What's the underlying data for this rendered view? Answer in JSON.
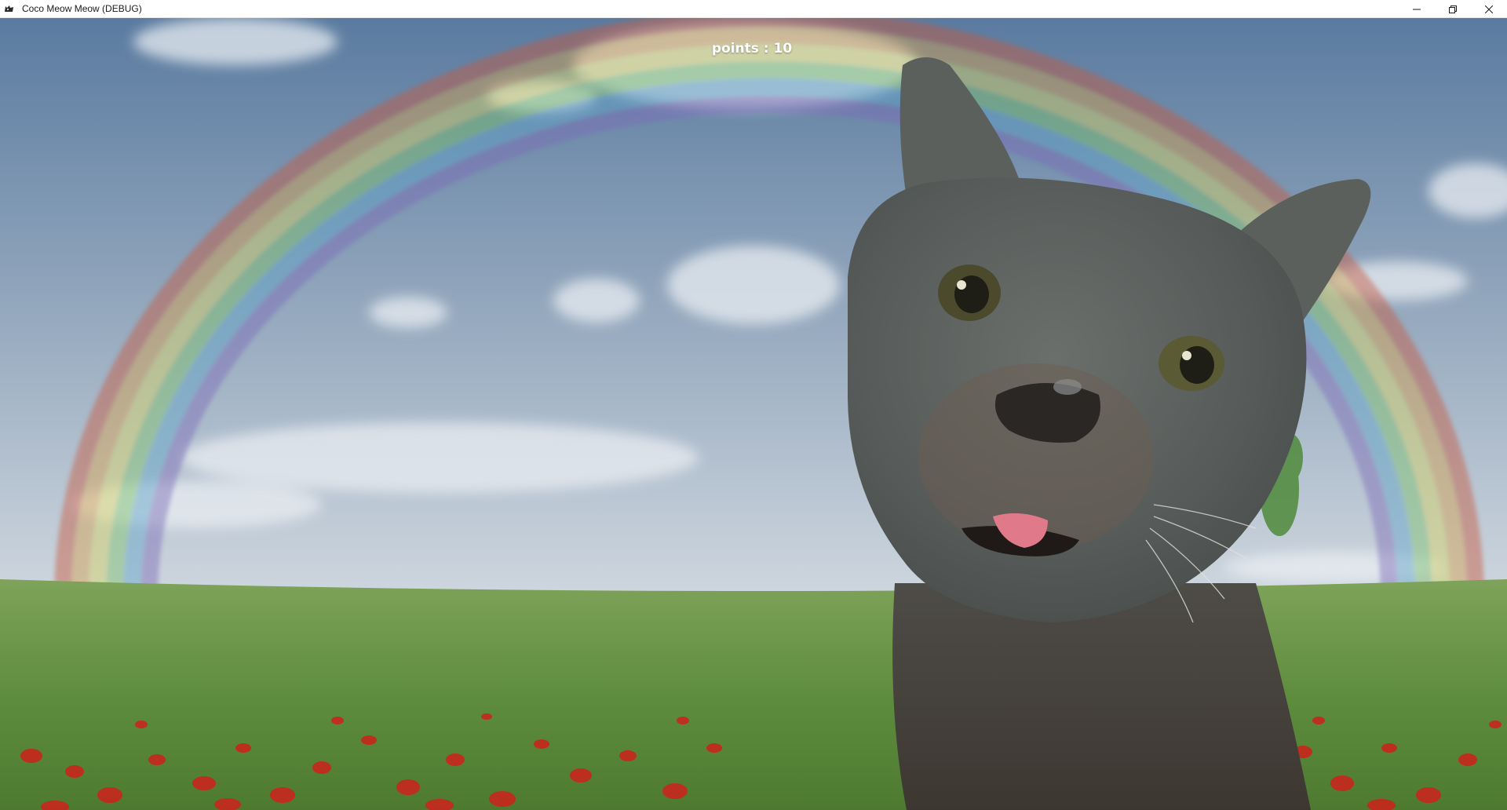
{
  "window": {
    "title": "Coco Meow Meow (DEBUG)",
    "controls": {
      "minimize_icon": "minimize-icon",
      "maximize_icon": "restore-icon",
      "close_icon": "close-icon"
    }
  },
  "hud": {
    "points_text": "points : 10"
  },
  "scene": {
    "background": "rainbow-sky-over-poppy-field",
    "character": "grey-cat-face",
    "colors": {
      "sky_top": "#5e7fa3",
      "sky_bottom": "#c9d3dd",
      "grass": "#6d9a4a",
      "poppy": "#c8261b",
      "cat_fur": "#5f6360"
    }
  }
}
